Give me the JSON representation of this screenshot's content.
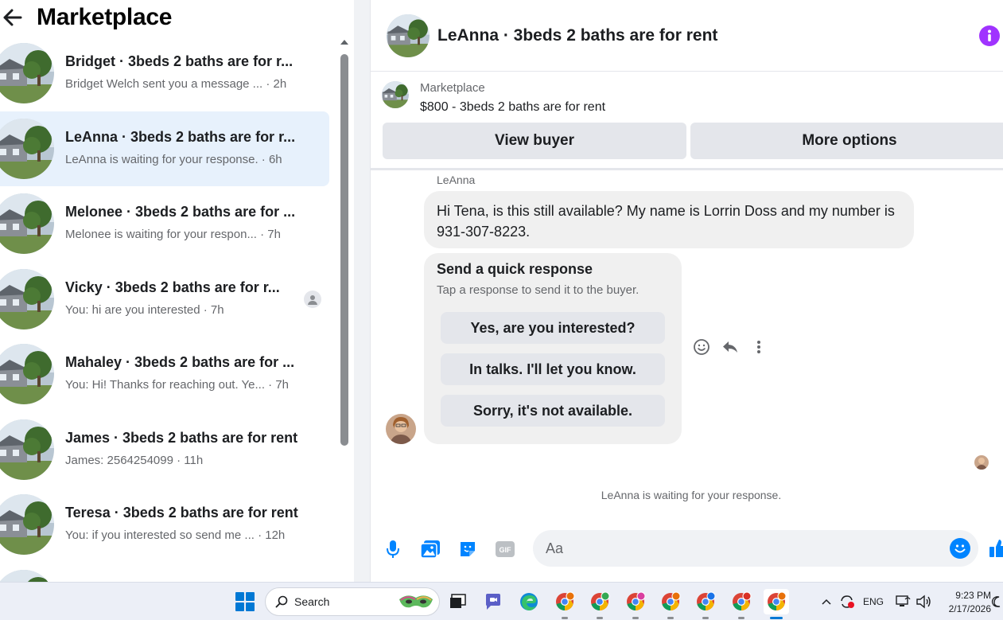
{
  "sidebar": {
    "title": "Marketplace",
    "conversations": [
      {
        "name": "Bridget · 3beds 2 baths are for r...",
        "preview": "Bridget Welch sent you a message ... · 2h",
        "active": false
      },
      {
        "name": "LeAnna · 3beds 2 baths are for r...",
        "preview": "LeAnna is waiting for your response. · 6h",
        "active": true
      },
      {
        "name": "Melonee · 3beds 2 baths are for ...",
        "preview": "Melonee is waiting for your respon... · 7h",
        "active": false
      },
      {
        "name": "Vicky · 3beds 2 baths are for r...",
        "preview": "You: hi are you interested · 7h",
        "active": false
      },
      {
        "name": "Mahaley · 3beds 2 baths are for ...",
        "preview": "You: Hi! Thanks for reaching out. Ye... · 7h",
        "active": false
      },
      {
        "name": "James · 3beds 2 baths are for rent",
        "preview": "James: 2564254099 · 11h",
        "active": false
      },
      {
        "name": "Teresa · 3beds 2 baths are for rent",
        "preview": "You: if you interested so send me ... · 12h",
        "active": false
      }
    ]
  },
  "chat": {
    "title": "LeAnna · 3beds 2 baths are for rent",
    "listing": {
      "source": "Marketplace",
      "price_title": "$800 - 3beds 2 baths are for rent",
      "view_buyer": "View buyer",
      "more_options": "More options"
    },
    "sender_name": "LeAnna",
    "message": "Hi Tena, is this still available? My name is Lorrin Doss and my number is 931-307-8223.",
    "quick_response": {
      "title": "Send a quick response",
      "subtitle": "Tap a response to send it to the buyer.",
      "options": [
        "Yes, are you interested?",
        "In talks. I'll let you know.",
        "Sorry, it's not available."
      ]
    },
    "status": "LeAnna is waiting for your response.",
    "composer_placeholder": "Aa"
  },
  "taskbar": {
    "search_label": "Search",
    "language": "ENG",
    "time": "9:23 PM",
    "date": "2/17/2026"
  },
  "colors": {
    "accent": "#0084ff",
    "active_conversation": "#e7f1fc",
    "info": "#a033ff",
    "bubble": "#f0f0f0"
  }
}
